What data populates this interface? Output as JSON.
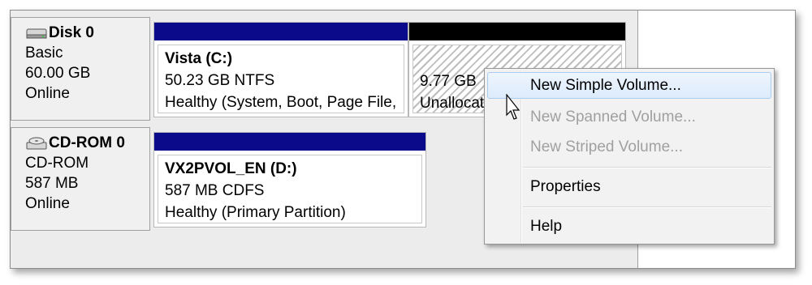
{
  "disks": [
    {
      "name": "Disk 0",
      "type": "Basic",
      "size": "60.00 GB",
      "status": "Online",
      "icon": "hard-disk-icon"
    },
    {
      "name": "CD-ROM 0",
      "type": "CD-ROM",
      "size": "587 MB",
      "status": "Online",
      "icon": "cd-rom-drive-icon"
    }
  ],
  "volumes": {
    "vista": {
      "title": "Vista  (C:)",
      "size_fs": "50.23 GB NTFS",
      "status": "Healthy (System, Boot, Page File,",
      "header_color": "#0a0a8a"
    },
    "unallocated": {
      "size": "9.77 GB",
      "status": "Unallocated",
      "header_color": "#000000"
    },
    "cdrom": {
      "title": "VX2PVOL_EN  (D:)",
      "size_fs": "587 MB CDFS",
      "status": "Healthy (Primary Partition)",
      "header_color": "#0a0a8a"
    }
  },
  "context_menu": {
    "items": [
      {
        "label": "New Simple Volume...",
        "enabled": true,
        "highlighted": true
      },
      {
        "label": "New Spanned Volume...",
        "enabled": false
      },
      {
        "label": "New Striped Volume...",
        "enabled": false
      },
      {
        "label": "Properties",
        "enabled": true
      },
      {
        "label": "Help",
        "enabled": true
      }
    ]
  },
  "colors": {
    "primary_partition": "#0a0a8a",
    "unallocated": "#000000",
    "menu_highlight_border": "#a8cdf1"
  }
}
